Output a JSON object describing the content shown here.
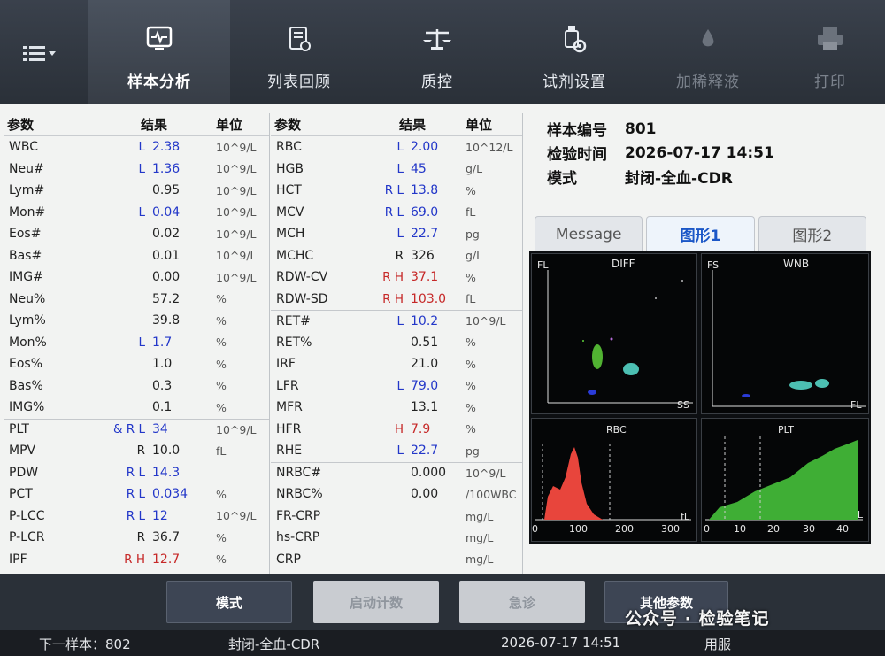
{
  "toolbar": {
    "menu_icon": "menu-icon",
    "items": [
      {
        "label": "样本分析",
        "icon": "monitor-icon"
      },
      {
        "label": "列表回顾",
        "icon": "list-review-icon"
      },
      {
        "label": "质控",
        "icon": "balance-icon"
      },
      {
        "label": "试剂设置",
        "icon": "reagent-gear-icon"
      },
      {
        "label": "加稀释液",
        "icon": "drop-icon"
      },
      {
        "label": "打印",
        "icon": "printer-icon"
      }
    ]
  },
  "table_left": {
    "headers": [
      "参数",
      "结果",
      "单位"
    ],
    "rows": [
      {
        "name": "WBC",
        "flag": "L",
        "value": "2.38",
        "unit": "10^9/L"
      },
      {
        "name": "Neu#",
        "flag": "L",
        "value": "1.36",
        "unit": "10^9/L"
      },
      {
        "name": "Lym#",
        "flag": "",
        "value": "0.95",
        "unit": "10^9/L"
      },
      {
        "name": "Mon#",
        "flag": "L",
        "value": "0.04",
        "unit": "10^9/L"
      },
      {
        "name": "Eos#",
        "flag": "",
        "value": "0.02",
        "unit": "10^9/L"
      },
      {
        "name": "Bas#",
        "flag": "",
        "value": "0.01",
        "unit": "10^9/L"
      },
      {
        "name": "IMG#",
        "flag": "",
        "value": "0.00",
        "unit": "10^9/L"
      },
      {
        "name": "Neu%",
        "flag": "",
        "value": "57.2",
        "unit": "%"
      },
      {
        "name": "Lym%",
        "flag": "",
        "value": "39.8",
        "unit": "%"
      },
      {
        "name": "Mon%",
        "flag": "L",
        "value": "1.7",
        "unit": "%"
      },
      {
        "name": "Eos%",
        "flag": "",
        "value": "1.0",
        "unit": "%"
      },
      {
        "name": "Bas%",
        "flag": "",
        "value": "0.3",
        "unit": "%"
      },
      {
        "name": "IMG%",
        "flag": "",
        "value": "0.1",
        "unit": "%"
      },
      {
        "name": "PLT",
        "flag": "& R L",
        "value": "34",
        "unit": "10^9/L"
      },
      {
        "name": "MPV",
        "flag": "R",
        "value": "10.0",
        "unit": "fL"
      },
      {
        "name": "PDW",
        "flag": "R L",
        "value": "14.3",
        "unit": ""
      },
      {
        "name": "PCT",
        "flag": "R L",
        "value": "0.034",
        "unit": "%"
      },
      {
        "name": "P-LCC",
        "flag": "R L",
        "value": "12",
        "unit": "10^9/L"
      },
      {
        "name": "P-LCR",
        "flag": "R",
        "value": "36.7",
        "unit": "%"
      },
      {
        "name": "IPF",
        "flag": "R H",
        "value": "12.7",
        "unit": "%"
      }
    ]
  },
  "table_right": {
    "headers": [
      "参数",
      "结果",
      "单位"
    ],
    "rows": [
      {
        "name": "RBC",
        "flag": "L",
        "value": "2.00",
        "unit": "10^12/L"
      },
      {
        "name": "HGB",
        "flag": "L",
        "value": "45",
        "unit": "g/L"
      },
      {
        "name": "HCT",
        "flag": "R L",
        "value": "13.8",
        "unit": "%"
      },
      {
        "name": "MCV",
        "flag": "R L",
        "value": "69.0",
        "unit": "fL"
      },
      {
        "name": "MCH",
        "flag": "L",
        "value": "22.7",
        "unit": "pg"
      },
      {
        "name": "MCHC",
        "flag": "R",
        "value": "326",
        "unit": "g/L"
      },
      {
        "name": "RDW-CV",
        "flag": "R H",
        "value": "37.1",
        "unit": "%"
      },
      {
        "name": "RDW-SD",
        "flag": "R H",
        "value": "103.0",
        "unit": "fL"
      },
      {
        "name": "RET#",
        "flag": "L",
        "value": "10.2",
        "unit": "10^9/L"
      },
      {
        "name": "RET%",
        "flag": "",
        "value": "0.51",
        "unit": "%"
      },
      {
        "name": "IRF",
        "flag": "",
        "value": "21.0",
        "unit": "%"
      },
      {
        "name": "LFR",
        "flag": "L",
        "value": "79.0",
        "unit": "%"
      },
      {
        "name": "MFR",
        "flag": "",
        "value": "13.1",
        "unit": "%"
      },
      {
        "name": "HFR",
        "flag": "H",
        "value": "7.9",
        "unit": "%"
      },
      {
        "name": "RHE",
        "flag": "L",
        "value": "22.7",
        "unit": "pg"
      },
      {
        "name": "NRBC#",
        "flag": "",
        "value": "0.000",
        "unit": "10^9/L"
      },
      {
        "name": "NRBC%",
        "flag": "",
        "value": "0.00",
        "unit": "/100WBC"
      },
      {
        "name": "FR-CRP",
        "flag": "",
        "value": "",
        "unit": "mg/L"
      },
      {
        "name": "hs-CRP",
        "flag": "",
        "value": "",
        "unit": "mg/L"
      },
      {
        "name": "CRP",
        "flag": "",
        "value": "",
        "unit": "mg/L"
      }
    ]
  },
  "sample_info": {
    "id_label": "样本编号",
    "id_value": "801",
    "time_label": "检验时间",
    "time_value": "2026-07-17 14:51",
    "mode_label": "模式",
    "mode_value": "封闭-全血-CDR"
  },
  "tabs": [
    {
      "label": "Message",
      "active": false
    },
    {
      "label": "图形1",
      "active": true
    },
    {
      "label": "图形2",
      "active": false
    }
  ],
  "graphs": {
    "diff": {
      "title": "DIFF",
      "y_axis": "FL",
      "x_axis": "SS"
    },
    "wnb": {
      "title": "WNB",
      "y_axis": "FS",
      "x_axis": "FL"
    },
    "rbc": {
      "title": "RBC",
      "unit": "fL",
      "ticks": [
        "0",
        "100",
        "200",
        "300"
      ]
    },
    "plt": {
      "title": "PLT",
      "unit": "fL",
      "ticks": [
        "0",
        "10",
        "20",
        "30",
        "40"
      ]
    }
  },
  "buttons": [
    {
      "label": "模式",
      "enabled": true
    },
    {
      "label": "启动计数",
      "enabled": false
    },
    {
      "label": "急诊",
      "enabled": false
    },
    {
      "label": "其他参数",
      "enabled": true
    }
  ],
  "status": {
    "next_sample": "下一样本：802",
    "mode": "封闭-全血-CDR",
    "datetime": "2026-07-17 14:51",
    "user": "用服"
  },
  "watermark": "公众号 · 检验笔记",
  "colors": {
    "flag_low": "#2337c9",
    "flag_high": "#c62828",
    "rbc_fill": "#e8453c",
    "plt_fill": "#3fae35"
  }
}
